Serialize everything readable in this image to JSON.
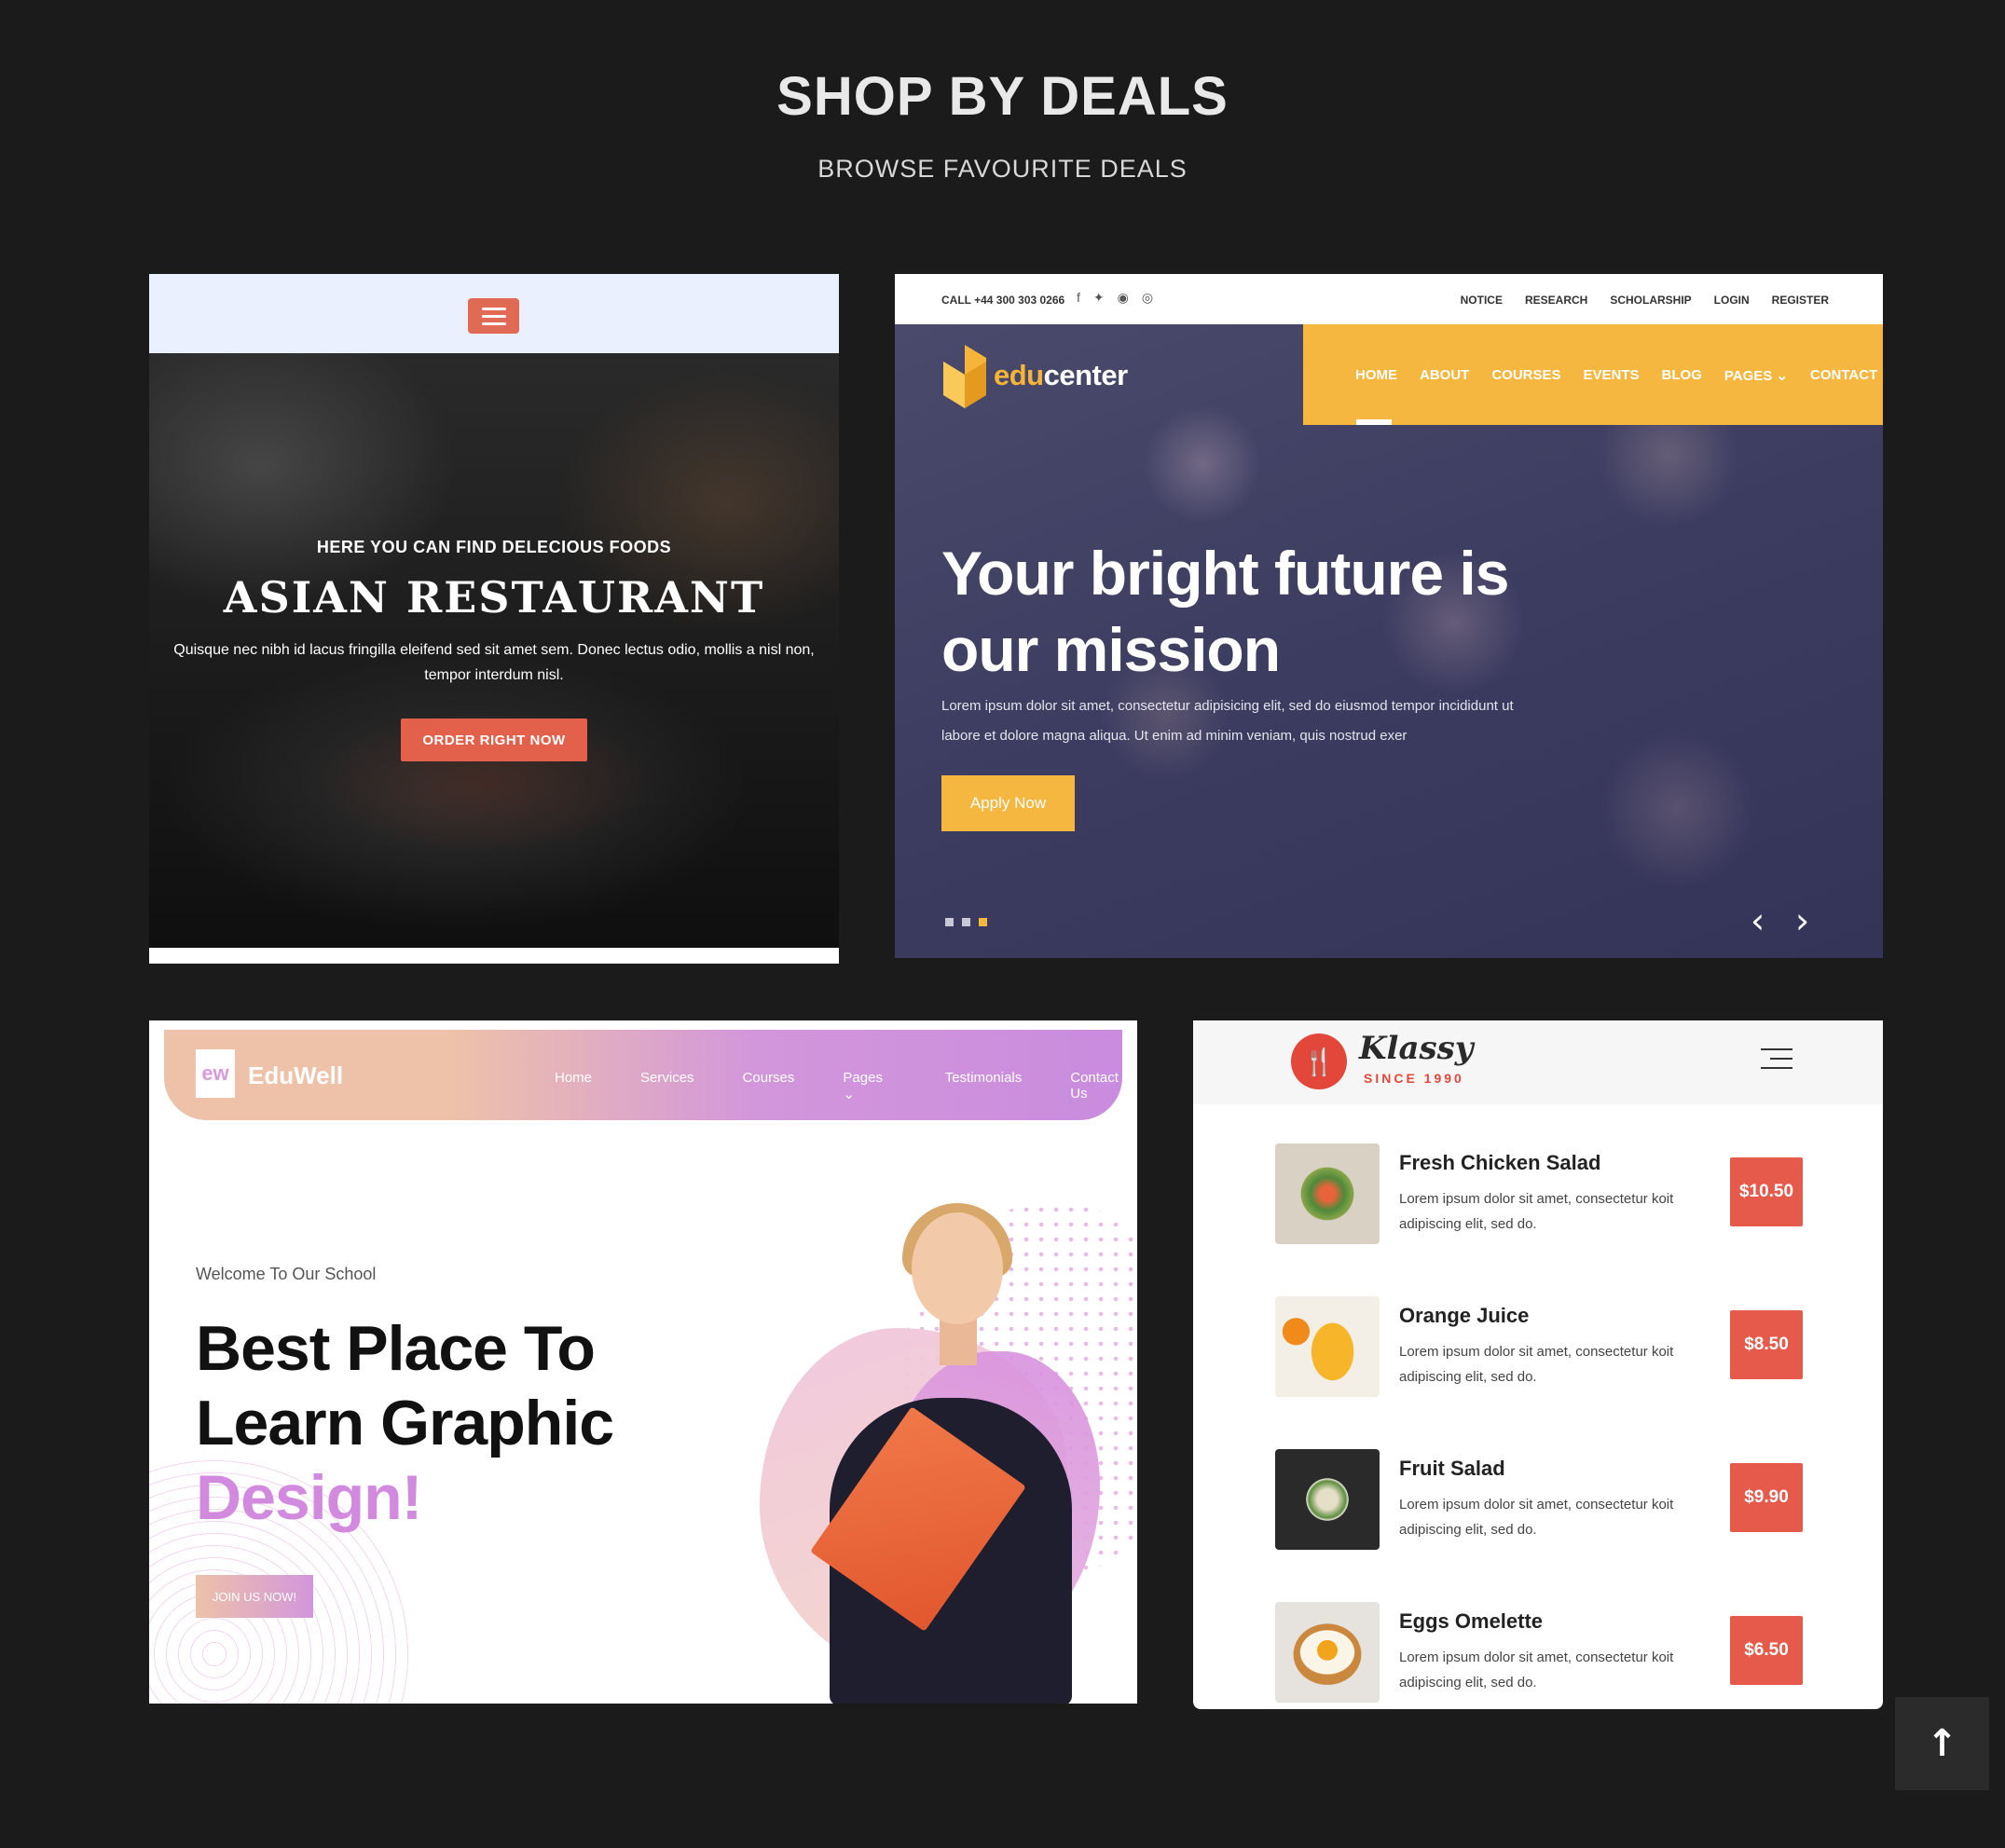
{
  "section": {
    "title": "SHOP BY DEALS",
    "subtitle": "BROWSE FAVOURITE DEALS"
  },
  "restaurant_card": {
    "menu_icon": "hamburger-menu-icon",
    "kicker": "HERE YOU CAN FIND DELECIOUS FOODS",
    "title": "ASIAN RESTAURANT",
    "text": "Quisque nec nibh id lacus fringilla eleifend sed sit amet sem. Donec lectus odio, mollis a nisl non, tempor interdum nisl.",
    "button": "ORDER RIGHT NOW",
    "accent_color": "#e3604b"
  },
  "educenter_card": {
    "call": "CALL +44 300 303 0266",
    "social_icons": [
      "facebook-icon",
      "twitter-icon",
      "github-icon",
      "instagram-icon"
    ],
    "top_links": [
      "NOTICE",
      "RESEARCH",
      "SCHOLARSHIP",
      "LOGIN",
      "REGISTER"
    ],
    "logo": {
      "part1": "edu",
      "part2": "center"
    },
    "nav": [
      "HOME",
      "ABOUT",
      "COURSES",
      "EVENTS",
      "BLOG",
      "PAGES ⌄",
      "CONTACT"
    ],
    "headline_line1": "Your bright future is",
    "headline_line2": "our mission",
    "text": "Lorem ipsum dolor sit amet, consectetur adipisicing elit, sed do eiusmod tempor incididunt ut labore et dolore magna aliqua. Ut enim ad minim veniam, quis nostrud exer",
    "button": "Apply Now",
    "prev": "‹",
    "next": "›",
    "accent_color": "#f5b73f"
  },
  "eduwell_card": {
    "logo": "ew",
    "brand": "EduWell",
    "nav": [
      "Home",
      "Services",
      "Courses",
      "Pages ⌄",
      "Testimonials",
      "Contact Us"
    ],
    "welcome": "Welcome To Our School",
    "headline_line1": "Best Place To",
    "headline_line2": "Learn Graphic",
    "headline_accent": "Design!",
    "button": "JOIN US NOW!",
    "accent_color": "#d18ade"
  },
  "klassy_card": {
    "logo_icon": "fork-knife-icon",
    "logo": "Klassy",
    "since": "SINCE 1990",
    "menu_icon": "hamburger-menu-icon",
    "items": [
      {
        "name": "Fresh Chicken Salad",
        "desc": "Lorem ipsum dolor sit amet, consectetur koit adipiscing elit, sed do.",
        "price": "$10.50"
      },
      {
        "name": "Orange Juice",
        "desc": "Lorem ipsum dolor sit amet, consectetur koit adipiscing elit, sed do.",
        "price": "$8.50"
      },
      {
        "name": "Fruit Salad",
        "desc": "Lorem ipsum dolor sit amet, consectetur koit adipiscing elit, sed do.",
        "price": "$9.90"
      },
      {
        "name": "Eggs Omelette",
        "desc": "Lorem ipsum dolor sit amet, consectetur koit adipiscing elit, sed do.",
        "price": "$6.50"
      }
    ],
    "accent_color": "#e55a4a"
  },
  "back_to_top": "↑"
}
